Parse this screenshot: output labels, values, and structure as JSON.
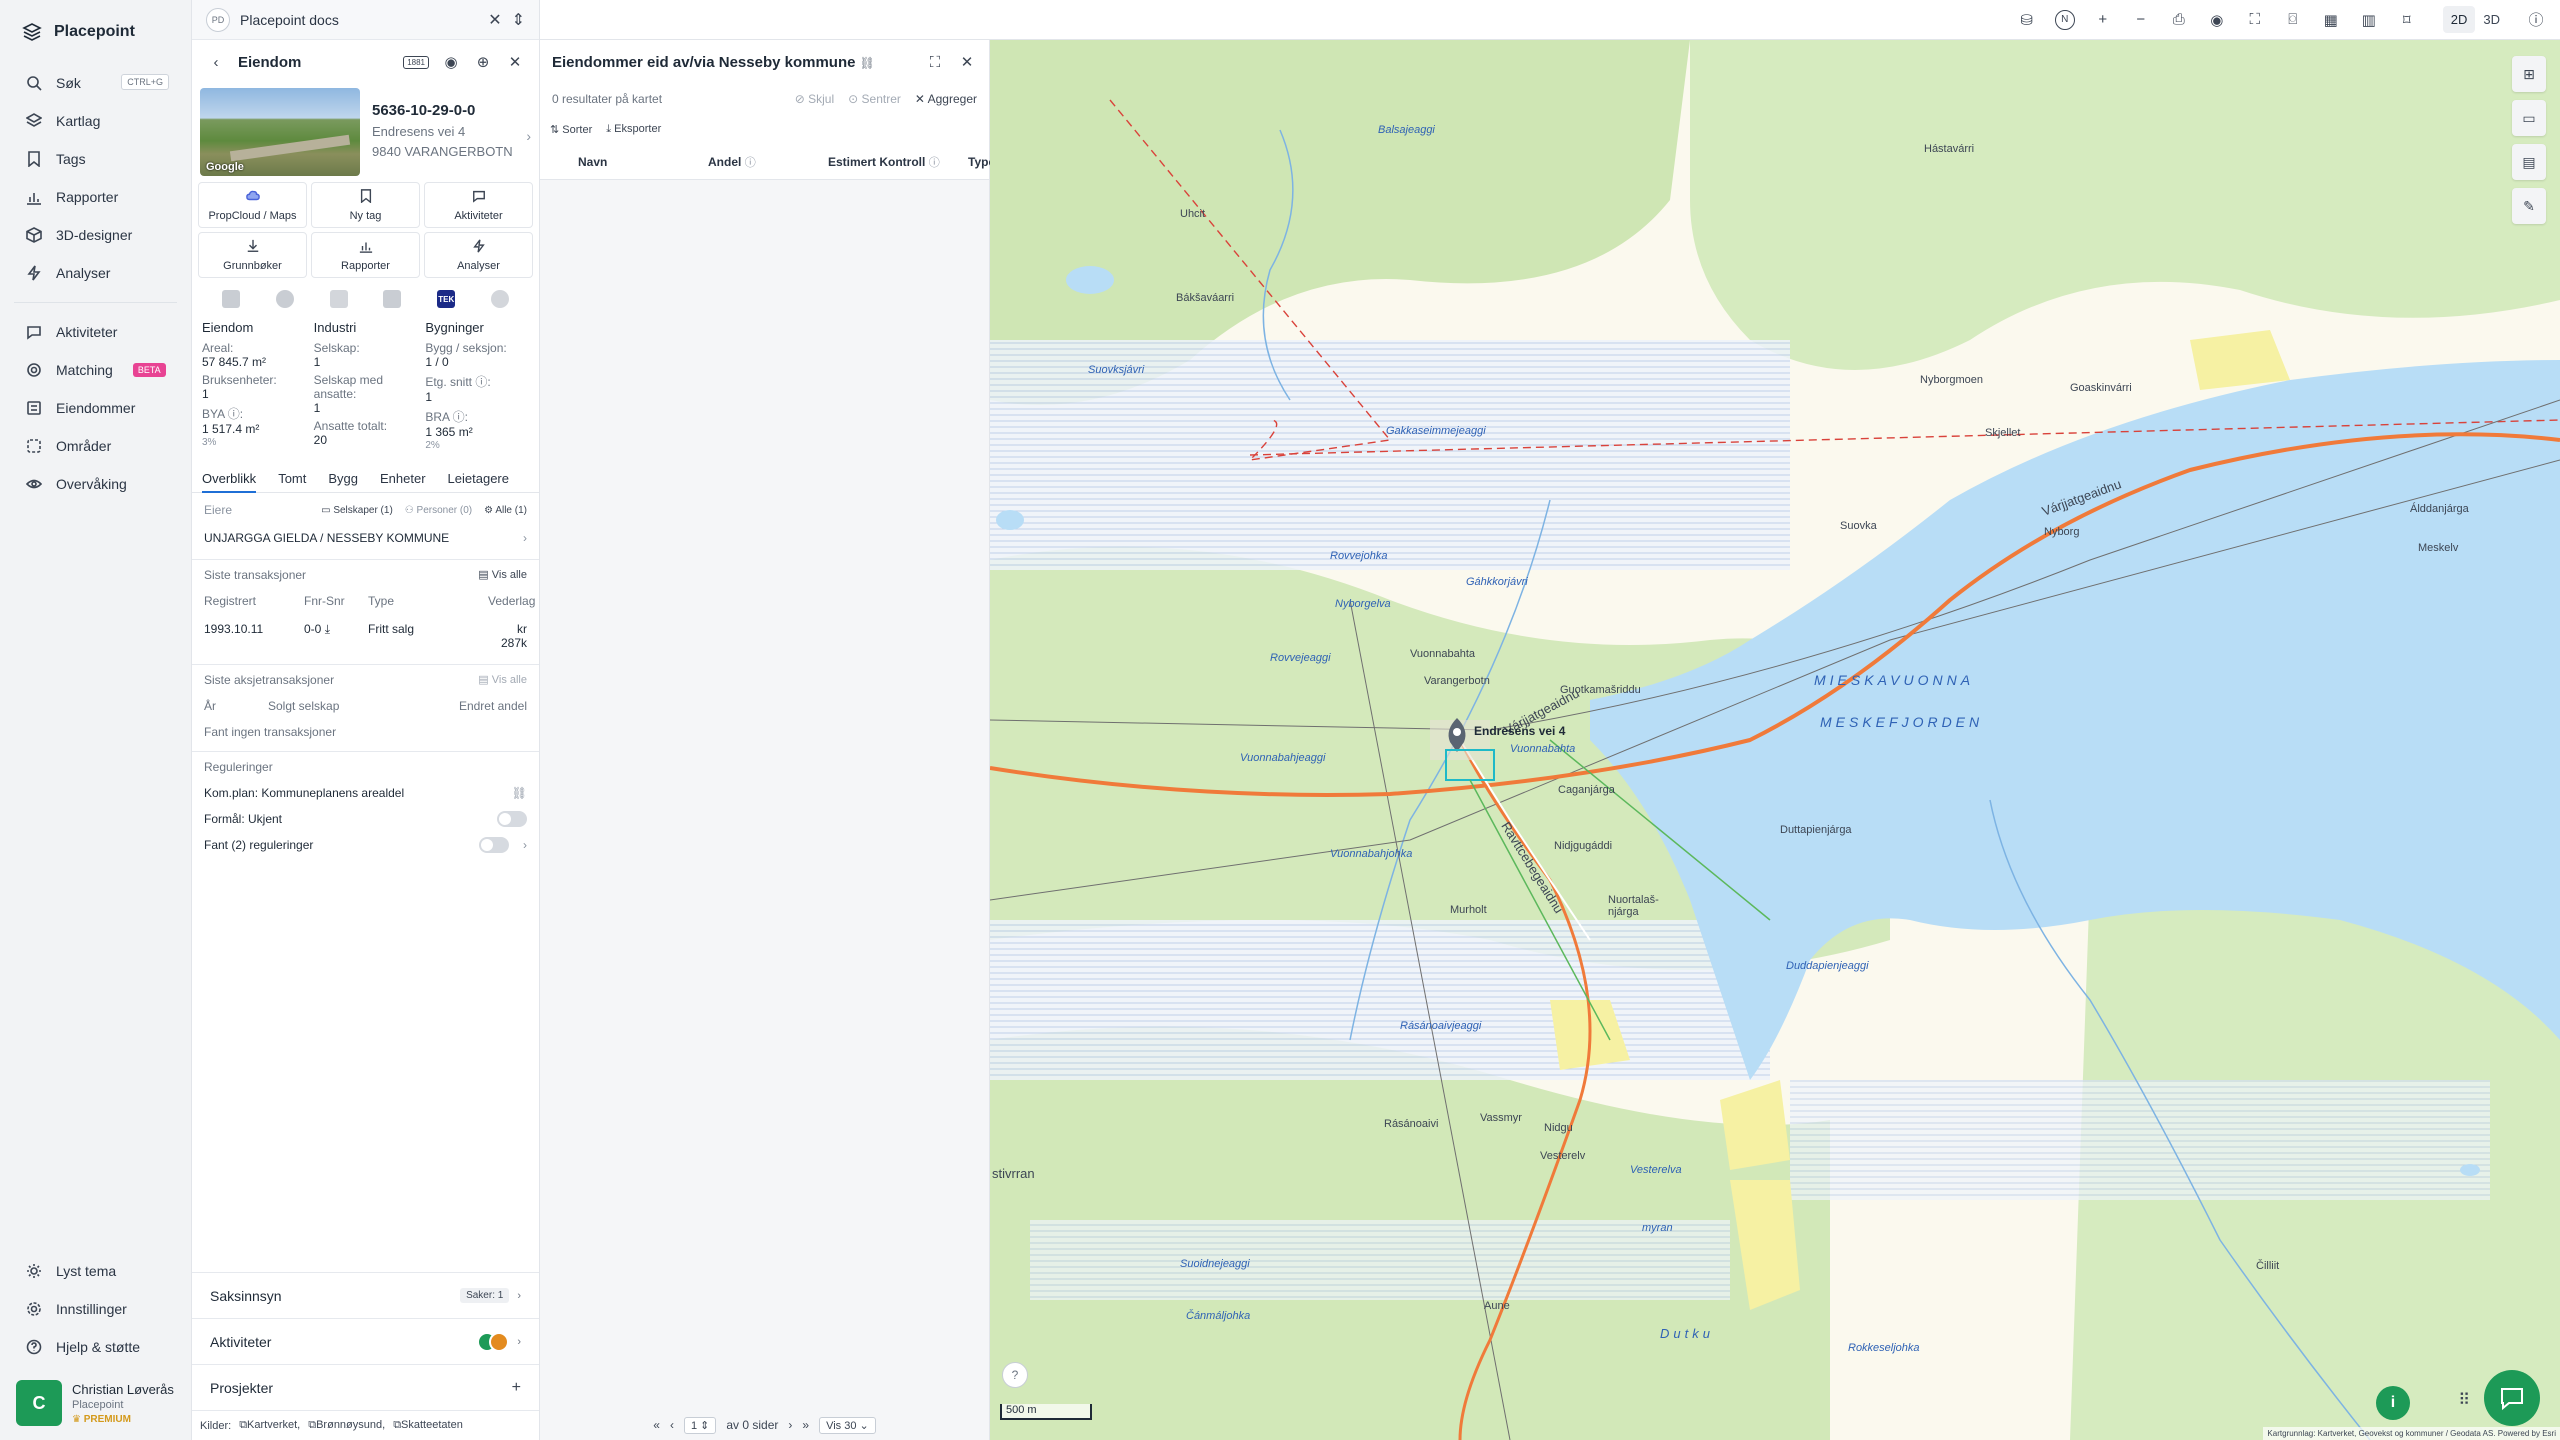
{
  "app": {
    "name": "Placepoint"
  },
  "nav": {
    "items": [
      {
        "label": "Søk",
        "icon": "search-icon",
        "shortcut": "CTRL+G"
      },
      {
        "label": "Kartlag",
        "icon": "layers-icon"
      },
      {
        "label": "Tags",
        "icon": "bookmark-icon"
      },
      {
        "label": "Rapporter",
        "icon": "chart-icon"
      },
      {
        "label": "3D-designer",
        "icon": "cube-icon"
      },
      {
        "label": "Analyser",
        "icon": "bolt-icon"
      }
    ],
    "items2": [
      {
        "label": "Aktiviteter",
        "icon": "chat-icon"
      },
      {
        "label": "Matching",
        "icon": "target-icon",
        "badge": "BETA"
      },
      {
        "label": "Eiendommer",
        "icon": "building-icon"
      },
      {
        "label": "Områder",
        "icon": "area-icon"
      },
      {
        "label": "Overvåking",
        "icon": "eye-icon"
      }
    ],
    "bottom": [
      {
        "label": "Lyst tema",
        "icon": "sun-icon"
      },
      {
        "label": "Innstillinger",
        "icon": "gear-icon"
      },
      {
        "label": "Hjelp & støtte",
        "icon": "help-icon"
      }
    ],
    "user": {
      "initial": "C",
      "name": "Christian Løverås",
      "org": "Placepoint",
      "plan": "PREMIUM"
    }
  },
  "doc_tab": {
    "badge": "PD",
    "title": "Placepoint docs"
  },
  "property": {
    "header": "Eiendom",
    "gnr": "5636-10-29-0-0",
    "address": "Endresens vei 4",
    "postal": "9840 VARANGERBOTN",
    "photo_label": "Google",
    "actions": [
      {
        "label": "PropCloud / Maps",
        "icon": "cloud-icon"
      },
      {
        "label": "Ny tag",
        "icon": "bookmark-icon"
      },
      {
        "label": "Aktiviteter",
        "icon": "chat-icon"
      },
      {
        "label": "Grunnbøker",
        "icon": "download-icon"
      },
      {
        "label": "Rapporter",
        "icon": "chart-icon"
      },
      {
        "label": "Analyser",
        "icon": "bolt-icon"
      }
    ],
    "tek_label": "TEK",
    "stats": {
      "col1": {
        "title": "Eiendom",
        "areal_k": "Areal:",
        "areal_v": "57 845.7 m²",
        "bru_k": "Bruksenheter:",
        "bru_v": "1",
        "bya_k": "BYA ⓘ:",
        "bya_v": "1 517.4 m²",
        "bya_s": "3%"
      },
      "col2": {
        "title": "Industri",
        "sel_k": "Selskap:",
        "sel_v": "1",
        "ans_k": "Selskap med ansatte:",
        "ans_v": "1",
        "tot_k": "Ansatte totalt:",
        "tot_v": "20"
      },
      "col3": {
        "title": "Bygninger",
        "bygg_k": "Bygg / seksjon:",
        "bygg_v": "1 / 0",
        "etg_k": "Etg. snitt ⓘ:",
        "etg_v": "1",
        "bra_k": "BRA ⓘ:",
        "bra_v": "1 365 m²",
        "bra_s": "2%"
      }
    },
    "tabs": [
      "Overblikk",
      "Tomt",
      "Bygg",
      "Enheter",
      "Leietagere"
    ],
    "owners": {
      "label": "Eiere",
      "companies": "Selskaper (1)",
      "persons": "Personer (0)",
      "all": "Alle (1)",
      "owner": "UNJARGGA GIELDA / NESSEBY KOMMUNE"
    },
    "transactions": {
      "title": "Siste transaksjoner",
      "view_all": "Vis alle",
      "headers": [
        "Registrert",
        "Fnr-Snr",
        "Type",
        "Vederlag"
      ],
      "row": [
        "1993.10.11",
        "0-0",
        "Fritt salg",
        "kr 287k"
      ]
    },
    "stock": {
      "title": "Siste aksjetransaksjoner",
      "view_all": "Vis alle",
      "headers": [
        "År",
        "Solgt selskap",
        "Endret andel"
      ],
      "empty": "Fant ingen transaksjoner"
    },
    "regulations": {
      "title": "Reguleringer",
      "plan": "Kom.plan: Kommuneplanens arealdel",
      "purpose": "Formål: Ukjent",
      "found": "Fant (2) reguleringer"
    },
    "accordions": [
      {
        "label": "Saksinnsyn",
        "meta": "Saker:",
        "count": "1"
      },
      {
        "label": "Aktiviteter"
      },
      {
        "label": "Prosjekter"
      }
    ],
    "sources": {
      "label": "Kilder:",
      "items": [
        "Kartverket,",
        "Brønnøysund,",
        "Skatteetaten"
      ]
    }
  },
  "owned": {
    "title": "Eiendommer eid av/via Nesseby kommune",
    "results": "0 resultater på kartet",
    "hide": "Skjul",
    "center": "Sentrer",
    "aggregate": "Aggreger",
    "sort": "Sorter",
    "export": "Eksporter",
    "columns": [
      "Navn",
      "Andel",
      "Estimert Kontroll",
      "Type"
    ],
    "pager": {
      "page": "1",
      "of": "av 0 sider",
      "show": "Vis 30"
    }
  },
  "topbar": {
    "mode2d": "2D",
    "mode3d": "3D",
    "north": "N"
  },
  "map": {
    "scale": "500 m",
    "attribution": "Kartgrunnlag: Kartverket, Geovekst og kommuner / Geodata AS. Powered by Esri",
    "labels": {
      "uhcit": "Uhcit",
      "baksavarri": "Bákšaváarri",
      "hastavarri": "Hástavárri",
      "goaskinvarri": "Goaskinvárri",
      "nyborgmoen": "Nyborgmoen",
      "skjellet": "Skjellet",
      "suovka": "Suovka",
      "nyborg": "Nyborg",
      "alddanjarga": "Álddanjárga",
      "meskelv": "Meskelv",
      "vuonnabahta": "Vuonnabahta",
      "varangerbotn": "Varangerbotn",
      "guotkamasriddu": "Guotkamašriddu",
      "caganjarga": "Caganjárga",
      "duttapienjarga": "Duttapienjárga",
      "nidjgugaddi": "Nidjgugáddi",
      "nuortalas": "Nuortalaš-njárga",
      "murholt": "Murholt",
      "rasanoaivi": "Rásánoaivi",
      "vassmyr": "Vassmyr",
      "nidgu": "Nidgu",
      "vesterelv": "Vesterelv",
      "aune": "Aune",
      "cilliit": "Čilliit",
      "stivrran": "stivrran",
      "dutku": "Dutku",
      "mieska": "MIESKAVUONNA",
      "meske": "MESKEFJORDEN",
      "varjatgeaidnu": "Várjjatgeaidnu",
      "ravttcebegeaidnu": "Ravttcebegeaidnu",
      "balsajeaggi": "Balsajeaggi",
      "gakkaseimmejeaggi": "Gakkaseimmejeaggi",
      "suovksjavri": "Suovksjávri",
      "gahkkorjavri": "Gáhkkorjávri",
      "rovvejohka": "Rovvejohka",
      "nyborgelva": "Nyborgelva",
      "rovvejeaggi": "Rovvejeaggi",
      "vuonnabahjeaggi": "Vuonnabahjeaggi",
      "vuonnabahjohka": "Vuonnabahjohka",
      "rasanoaivjeaggi": "Rásánoaivjeaggi",
      "duddapienjeaggi": "Duddapienjeaggi",
      "suoidnejeaggi": "Suoidnejeaggi",
      "canmaljohka": "Čánmáljohka",
      "rokkeseljohka": "Rokkeseljohka",
      "myran": "myran",
      "vesterelva": "Vesterelva",
      "endresens": "Endresens vei 4"
    }
  },
  "colors": {
    "accent": "#1f6fd6",
    "green": "#1d9a57",
    "water": "#b8ddf6",
    "road": "#f07a3a"
  }
}
